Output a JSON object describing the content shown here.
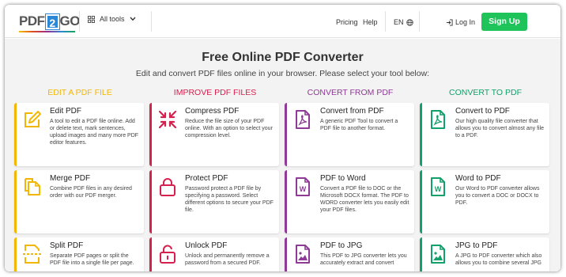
{
  "header": {
    "logo_left": "PDF",
    "logo_mid": "2",
    "logo_right": "GO",
    "all_tools": "All tools",
    "pricing": "Pricing",
    "help": "Help",
    "lang": "EN",
    "login": "Log In",
    "signup": "Sign Up"
  },
  "page": {
    "title": "Free Online PDF Converter",
    "subtitle": "Edit and convert PDF files online in your browser. Please select your tool below:"
  },
  "colors": {
    "edit": "#f2b705",
    "improve": "#d6204e",
    "convert_from": "#8e3a96",
    "convert_to": "#12a06b",
    "signup": "#1ec35a"
  },
  "columns": [
    {
      "heading": "EDIT A PDF FILE",
      "cards": [
        {
          "icon": "edit-pencil-icon",
          "title": "Edit PDF",
          "desc": "A tool to edit a PDF file online. Add or delete text, mark sentences, upload images and many more PDF editor features."
        },
        {
          "icon": "merge-files-icon",
          "title": "Merge PDF",
          "desc": "Combine PDF files in any desired order with our PDF merger."
        },
        {
          "icon": "split-scissors-icon",
          "title": "Split PDF",
          "desc": "Separate PDF pages or split the PDF file into a single file per page."
        }
      ]
    },
    {
      "heading": "IMPROVE PDF FILES",
      "cards": [
        {
          "icon": "compress-arrows-icon",
          "title": "Compress PDF",
          "desc": "Reduce the file size of your PDF online. With an option to select your compression level."
        },
        {
          "icon": "lock-icon",
          "title": "Protect PDF",
          "desc": "Password protect a PDF file by specifying a password. Select different options to secure your PDF file."
        },
        {
          "icon": "unlock-icon",
          "title": "Unlock PDF",
          "desc": "Unlock and permanently remove a password from a secured PDF."
        }
      ]
    },
    {
      "heading": "CONVERT FROM PDF",
      "cards": [
        {
          "icon": "pdf-file-icon",
          "title": "Convert from PDF",
          "desc": "A generic PDF Tool to convert a PDF file to another format."
        },
        {
          "icon": "word-file-icon",
          "title": "PDF to Word",
          "desc": "Convert a PDF file to DOC or the Microsoft DOCX format. The PDF to WORD converter lets you easily edit your PDF files."
        },
        {
          "icon": "image-file-icon",
          "title": "PDF to JPG",
          "desc": "This PDF to JPG converter lets you accurately extract and convert"
        }
      ]
    },
    {
      "heading": "CONVERT TO PDF",
      "cards": [
        {
          "icon": "pdf-file-icon",
          "title": "Convert to PDF",
          "desc": "Our high quality file converter that allows you to convert almost any file to a PDF."
        },
        {
          "icon": "word-file-icon",
          "title": "Word to PDF",
          "desc": "Our Word to PDF converter allows you to convert a DOC or DOCX to PDF."
        },
        {
          "icon": "image-file-icon",
          "title": "JPG to PDF",
          "desc": "A JPG to PDF converter which also allows you to combine several JPG"
        }
      ]
    }
  ]
}
